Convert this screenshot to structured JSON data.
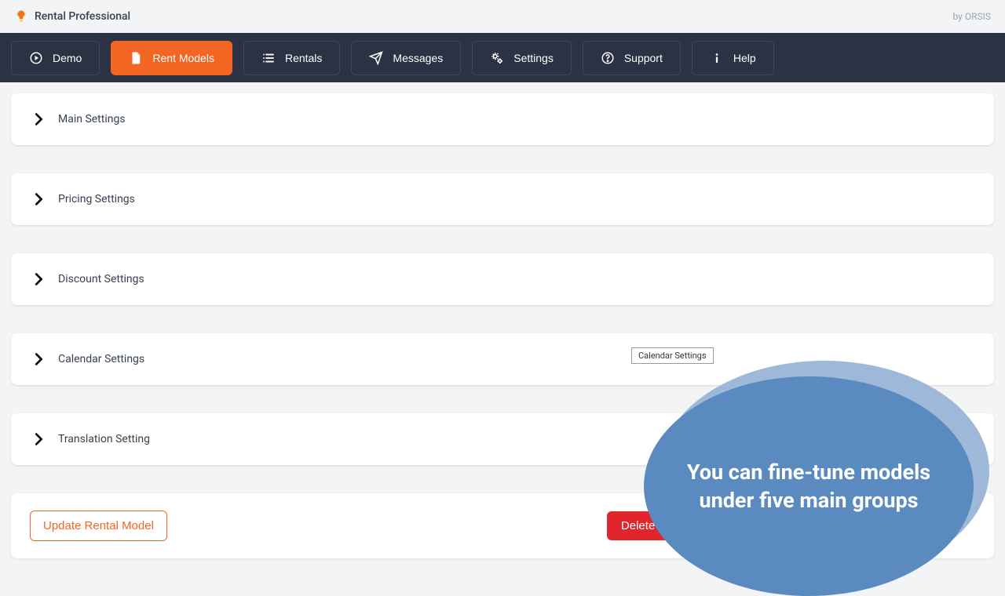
{
  "header": {
    "title": "Rental Professional",
    "byline": "by ORSIS"
  },
  "nav": [
    {
      "id": "demo",
      "label": "Demo",
      "active": false
    },
    {
      "id": "rent-models",
      "label": "Rent Models",
      "active": true
    },
    {
      "id": "rentals",
      "label": "Rentals",
      "active": false
    },
    {
      "id": "messages",
      "label": "Messages",
      "active": false
    },
    {
      "id": "settings",
      "label": "Settings",
      "active": false
    },
    {
      "id": "support",
      "label": "Support",
      "active": false
    },
    {
      "id": "help",
      "label": "Help",
      "active": false
    }
  ],
  "panels": [
    {
      "id": "main-settings",
      "label": "Main Settings"
    },
    {
      "id": "pricing-settings",
      "label": "Pricing Settings"
    },
    {
      "id": "discount-settings",
      "label": "Discount Settings"
    },
    {
      "id": "calendar-settings",
      "label": "Calendar Settings",
      "tooltip": "Calendar Settings"
    },
    {
      "id": "translation-setting",
      "label": "Translation Setting"
    }
  ],
  "actions": {
    "update": "Update Rental Model",
    "delete": "Delete Model"
  },
  "callout": {
    "text": "You can fine-tune models under five main groups"
  },
  "colors": {
    "navBg": "#2a3244",
    "accent": "#f26522",
    "danger": "#e0262c",
    "callout": "#5a8abf"
  }
}
